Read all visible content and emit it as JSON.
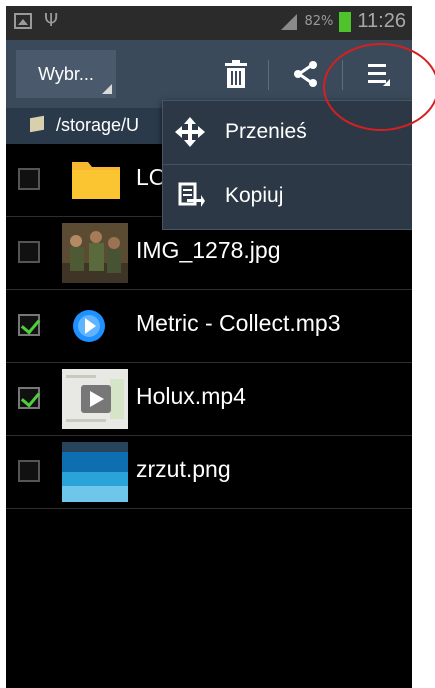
{
  "status_bar": {
    "battery": "82%",
    "time": "11:26"
  },
  "action_bar": {
    "select_label": "Wybr...",
    "delete_icon": "trash-icon",
    "share_icon": "share-icon",
    "menu_icon": "overflow-menu-icon"
  },
  "path": "/storage/U",
  "files": [
    {
      "name": "LO",
      "checked": false,
      "icon": "folder-icon"
    },
    {
      "name": "IMG_1278.jpg",
      "checked": false,
      "icon": "photo-thumbnail"
    },
    {
      "name": "Metric - Collect.mp3",
      "checked": true,
      "icon": "audio-icon"
    },
    {
      "name": "Holux.mp4",
      "checked": true,
      "icon": "video-thumbnail"
    },
    {
      "name": "zrzut.png",
      "checked": false,
      "icon": "screenshot-thumbnail"
    }
  ],
  "popup_menu": {
    "items": [
      {
        "label": "Przenieś",
        "icon": "move-icon"
      },
      {
        "label": "Kopiuj",
        "icon": "copy-icon"
      }
    ]
  },
  "colors": {
    "accent_check": "#4cd137",
    "action_bar": "#3a4a5a",
    "annotation": "#d62020"
  }
}
